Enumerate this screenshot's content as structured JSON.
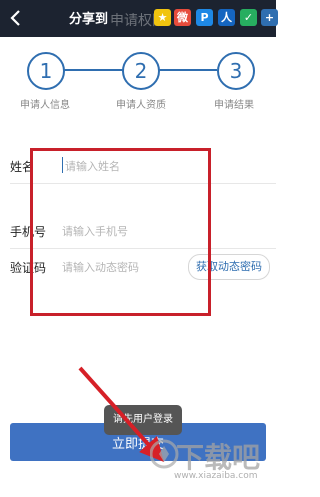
{
  "header": {
    "title": "申请权限",
    "share_label": "分享到"
  },
  "share_icons": [
    {
      "icon": "qzone-icon",
      "glyph": "★",
      "color": "#f1c40f"
    },
    {
      "icon": "weibo-icon",
      "glyph": "微",
      "color": "#e74c3c"
    },
    {
      "icon": "tencent-weibo-icon",
      "glyph": "P",
      "color": "#1e88e5"
    },
    {
      "icon": "renren-icon",
      "glyph": "人",
      "color": "#1565c0"
    },
    {
      "icon": "wechat-icon",
      "glyph": "✓",
      "color": "#27ae60"
    },
    {
      "icon": "more-icon",
      "glyph": "+",
      "color": "#2f6eb0"
    }
  ],
  "steps": [
    {
      "number": "1",
      "label": "申请人信息"
    },
    {
      "number": "2",
      "label": "申请人资质"
    },
    {
      "number": "3",
      "label": "申请结果"
    }
  ],
  "form": {
    "name_label": "姓名",
    "name_placeholder": "请输入姓名",
    "phone_label": "手机号",
    "phone_placeholder": "请输入手机号",
    "code_label": "验证码",
    "code_placeholder": "请输入动态密码",
    "get_code_label": "获取动态密码"
  },
  "toast": {
    "text": "请先用户登录"
  },
  "submit": {
    "label": "立即提交"
  },
  "watermark": {
    "brand": "下载吧",
    "url": "www.xiazaiba.com"
  }
}
